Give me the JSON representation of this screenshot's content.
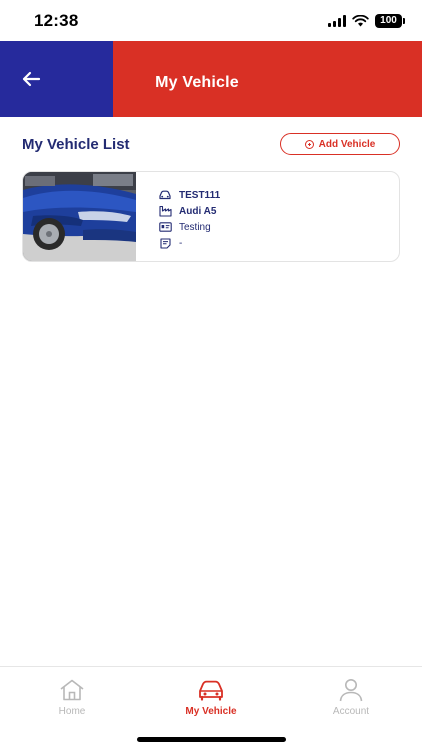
{
  "status_bar": {
    "time": "12:38",
    "battery": "100"
  },
  "header": {
    "title": "My Vehicle",
    "colors": {
      "left": "#262a9c",
      "right": "#d93025"
    }
  },
  "section": {
    "title": "My Vehicle List",
    "add_button_label": "Add Vehicle"
  },
  "vehicles": [
    {
      "plate": "TEST111",
      "model": "Audi A5",
      "status": "Testing",
      "note": "-",
      "icons": [
        "car-icon",
        "factory-icon",
        "id-card-icon",
        "note-icon"
      ]
    }
  ],
  "bottom_nav": {
    "items": [
      {
        "label": "Home",
        "icon": "home-icon",
        "active": false
      },
      {
        "label": "My Vehicle",
        "icon": "car-icon",
        "active": true
      },
      {
        "label": "Account",
        "icon": "user-icon",
        "active": false
      }
    ]
  },
  "colors": {
    "accent": "#d93025",
    "navy": "#232b72",
    "inactive": "#b8b8b8"
  }
}
